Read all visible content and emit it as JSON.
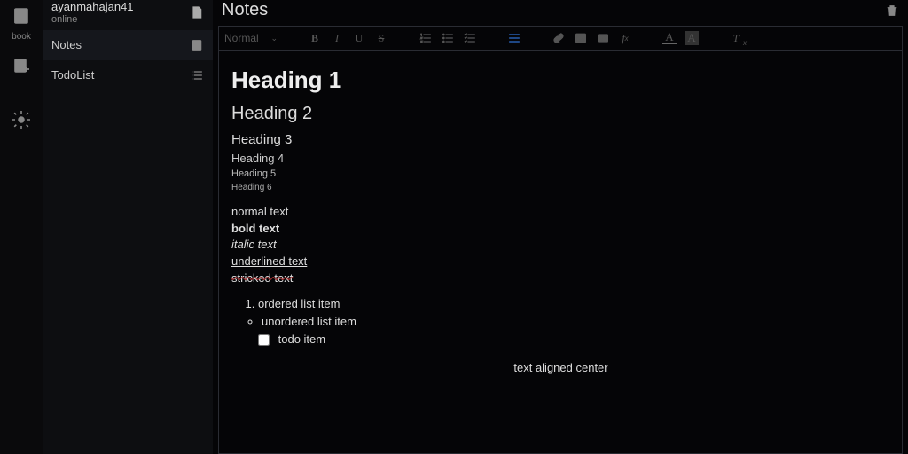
{
  "rail": {
    "book_label": "book"
  },
  "sidebar": {
    "username": "ayanmahajan41",
    "status": "online",
    "items": [
      {
        "label": "Notes"
      },
      {
        "label": "TodoList"
      }
    ]
  },
  "main": {
    "title": "Notes"
  },
  "toolbar": {
    "format_select": "Normal"
  },
  "content": {
    "h1": "Heading 1",
    "h2": "Heading 2",
    "h3": "Heading 3",
    "h4": "Heading 4",
    "h5": "Heading 5",
    "h6": "Heading 6",
    "normal": "normal text",
    "bold": "bold text",
    "italic": "italic text",
    "underline": "underlined text",
    "strike": "stricked text",
    "ol_item": "ordered list item",
    "ul_item": "unordered list item",
    "todo_item": "todo item",
    "center_text": "text aligned center"
  }
}
